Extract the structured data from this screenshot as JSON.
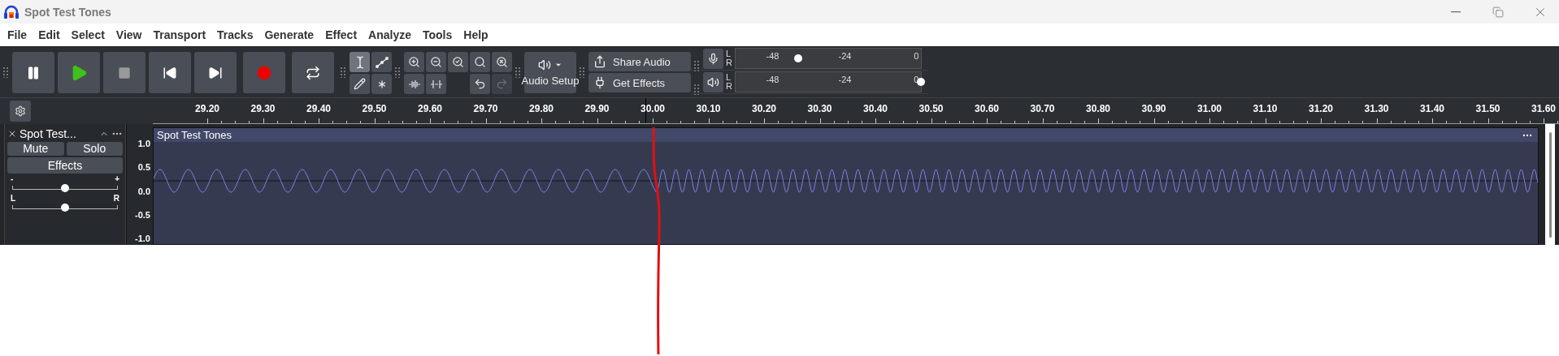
{
  "window": {
    "title": "Spot Test Tones"
  },
  "menu": [
    "File",
    "Edit",
    "Select",
    "View",
    "Transport",
    "Tracks",
    "Generate",
    "Effect",
    "Analyze",
    "Tools",
    "Help"
  ],
  "transport": [
    {
      "kind": "pause"
    },
    {
      "kind": "play"
    },
    {
      "kind": "stop"
    },
    {
      "kind": "skip-start"
    },
    {
      "kind": "skip-end"
    },
    {
      "kind": "record"
    },
    {
      "kind": "loop"
    }
  ],
  "tools": [
    {
      "kind": "select",
      "selected": true
    },
    {
      "kind": "envelope",
      "selected": false
    },
    {
      "kind": "draw",
      "selected": false
    },
    {
      "kind": "multi",
      "selected": false
    }
  ],
  "edit_tools": [
    {
      "kind": "zoom-in",
      "disabled": false
    },
    {
      "kind": "zoom-out",
      "disabled": false
    },
    {
      "kind": "fit-selection",
      "disabled": false
    },
    {
      "kind": "fit-project",
      "disabled": false
    },
    {
      "kind": "zoom-toggle",
      "disabled": false
    },
    {
      "kind": "trim",
      "disabled": false
    },
    {
      "kind": "silence",
      "disabled": false
    },
    {
      "kind": "undo",
      "disabled": false
    },
    {
      "kind": "redo",
      "disabled": true
    }
  ],
  "audio_setup": {
    "label": "Audio Setup"
  },
  "share": [
    {
      "kind": "share",
      "label": "Share Audio"
    },
    {
      "kind": "plug",
      "label": "Get Effects"
    }
  ],
  "meters": [
    {
      "kind": "record",
      "left": "L",
      "right": "R",
      "ticks": [
        "-48",
        "-24",
        "0"
      ],
      "level": 0.34
    },
    {
      "kind": "playback",
      "left": "L",
      "right": "R",
      "ticks": [
        "-48",
        "-24",
        "0"
      ],
      "level": 1
    }
  ],
  "ruler": [
    "29.20",
    "29.30",
    "29.40",
    "29.50",
    "29.60",
    "29.70",
    "29.80",
    "29.90",
    "30.00",
    "30.10",
    "30.20",
    "30.30",
    "30.40",
    "30.50",
    "30.60",
    "30.70",
    "30.80",
    "30.90",
    "31.00",
    "31.10",
    "31.20",
    "31.30",
    "31.40",
    "31.50",
    "31.60"
  ],
  "track": {
    "name": "Spot Test...",
    "mute": "Mute",
    "solo": "Solo",
    "effects": "Effects",
    "gain": {
      "low": "-",
      "high": "+",
      "level": 0.5
    },
    "pan": {
      "low": "L",
      "high": "R",
      "level": 0.5
    },
    "scale": [
      "1.0",
      "0.5",
      "0.0",
      "-0.5",
      "-1.0"
    ],
    "clip": {
      "title": "Spot Test Tones"
    }
  }
}
